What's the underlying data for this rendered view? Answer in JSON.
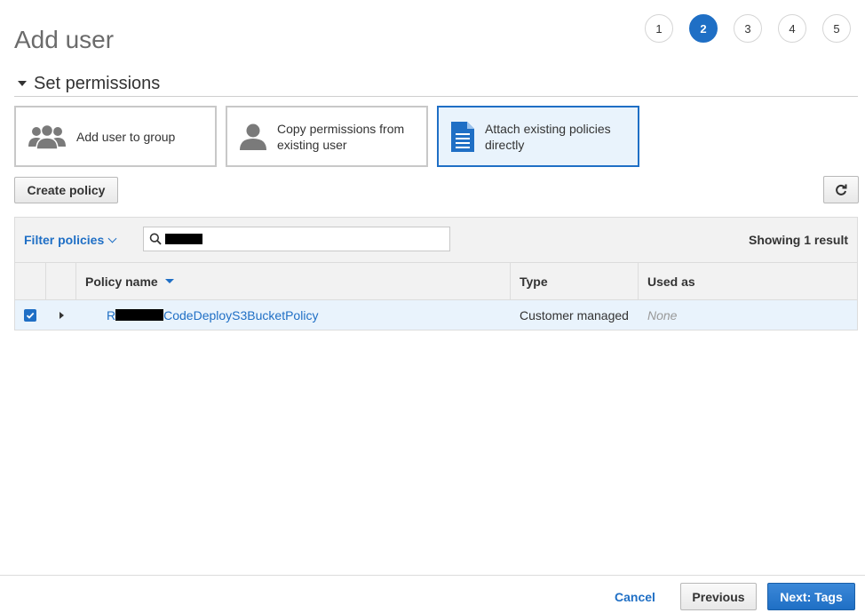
{
  "header": {
    "title": "Add user",
    "steps": [
      {
        "label": "1",
        "active": false
      },
      {
        "label": "2",
        "active": true
      },
      {
        "label": "3",
        "active": false
      },
      {
        "label": "4",
        "active": false
      },
      {
        "label": "5",
        "active": false
      }
    ]
  },
  "permissions": {
    "section_title": "Set permissions",
    "options": [
      {
        "label": "Add user to group",
        "icon": "group-icon",
        "selected": false
      },
      {
        "label": "Copy permissions from existing user",
        "icon": "user-icon",
        "selected": false
      },
      {
        "label": "Attach existing policies directly",
        "icon": "document-icon",
        "selected": true
      }
    ],
    "create_policy_label": "Create policy",
    "refresh_icon": "refresh-icon"
  },
  "policies_table": {
    "filter_label": "Filter policies",
    "search_value": "",
    "result_count": "Showing 1 result",
    "columns": {
      "policy_name": "Policy name",
      "type": "Type",
      "used_as": "Used as"
    },
    "rows": [
      {
        "checked": true,
        "policy_name_prefix": "R",
        "policy_name_suffix": "CodeDeployS3BucketPolicy",
        "type": "Customer managed",
        "used_as": "None"
      }
    ]
  },
  "footer": {
    "cancel_label": "Cancel",
    "previous_label": "Previous",
    "next_label": "Next: Tags"
  },
  "colors": {
    "accent": "#1f6fc5",
    "selected_bg": "#e9f3fc",
    "header_bg": "#f2f2f2"
  }
}
